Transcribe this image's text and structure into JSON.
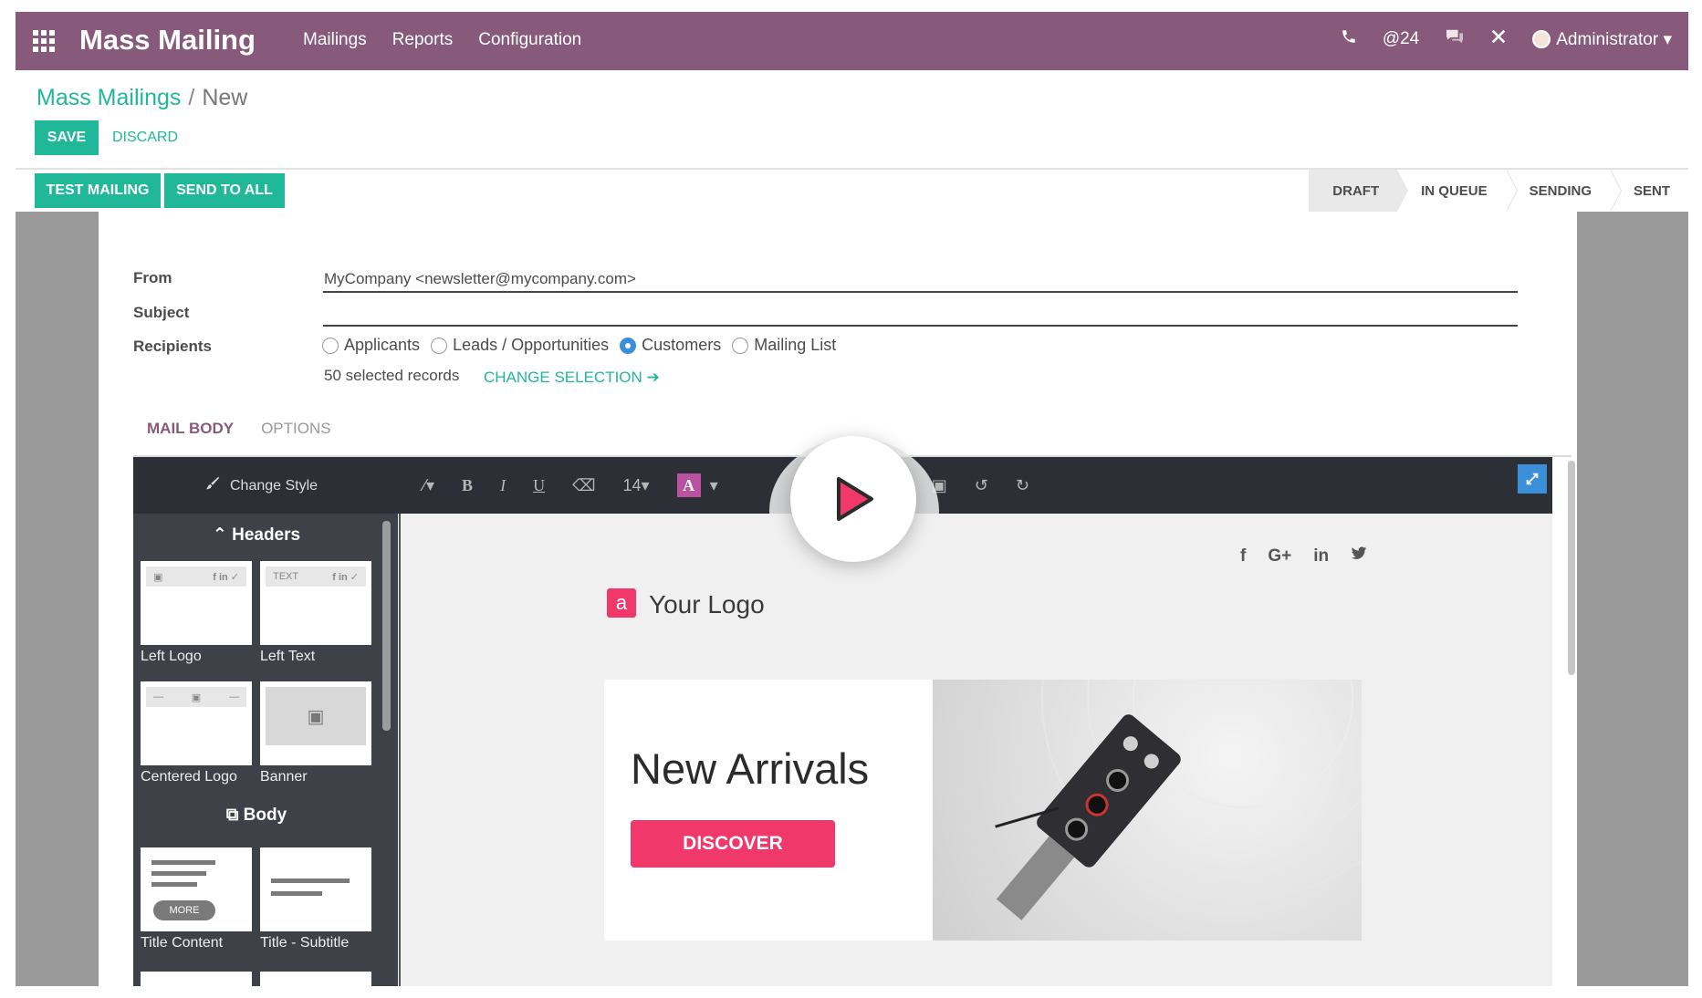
{
  "navbar": {
    "app_title": "Mass Mailing",
    "menu": [
      "Mailings",
      "Reports",
      "Configuration"
    ],
    "mentions_count": "@24",
    "user": "Administrator"
  },
  "breadcrumb": {
    "parent": "Mass Mailings",
    "separator": "/",
    "current": "New"
  },
  "actions": {
    "save": "SAVE",
    "discard": "DISCARD",
    "test_mailing": "TEST MAILING",
    "send_to_all": "SEND TO ALL"
  },
  "status_stages": [
    {
      "label": "DRAFT",
      "active": true
    },
    {
      "label": "IN QUEUE",
      "active": false
    },
    {
      "label": "SENDING",
      "active": false
    },
    {
      "label": "SENT",
      "active": false
    }
  ],
  "form": {
    "from_label": "From",
    "from_value": "MyCompany <newsletter@mycompany.com>",
    "subject_label": "Subject",
    "subject_value": "",
    "recipients_label": "Recipients",
    "recipients": [
      {
        "label": "Applicants",
        "checked": false
      },
      {
        "label": "Leads / Opportunities",
        "checked": false
      },
      {
        "label": "Customers",
        "checked": true
      },
      {
        "label": "Mailing List",
        "checked": false
      }
    ],
    "selected_records": "50 selected records",
    "change_selection": "CHANGE SELECTION"
  },
  "tabs": [
    {
      "label": "MAIL BODY",
      "active": true
    },
    {
      "label": "OPTIONS",
      "active": false
    }
  ],
  "editor": {
    "change_style": "Change Style",
    "font_size": "14",
    "color_letter": "A",
    "headers_title": "Headers",
    "body_title": "Body",
    "snippets": {
      "left_logo": "Left Logo",
      "left_text": "Left Text",
      "centered_logo": "Centered Logo",
      "banner": "Banner",
      "title_content": "Title Content",
      "title_subtitle": "Title - Subtitle",
      "text_tag": "TEXT",
      "more_tag": "MORE"
    },
    "content": {
      "logo_letter": "a",
      "logo_text": "Your Logo",
      "socials": [
        "f",
        "G+",
        "in",
        "t"
      ],
      "hero_title": "New Arrivals",
      "hero_button": "DISCOVER"
    }
  },
  "colors": {
    "brand": "#875a7b",
    "primary": "#21b799",
    "accent": "#f0386b",
    "radio_checked": "#3b8fd9"
  }
}
